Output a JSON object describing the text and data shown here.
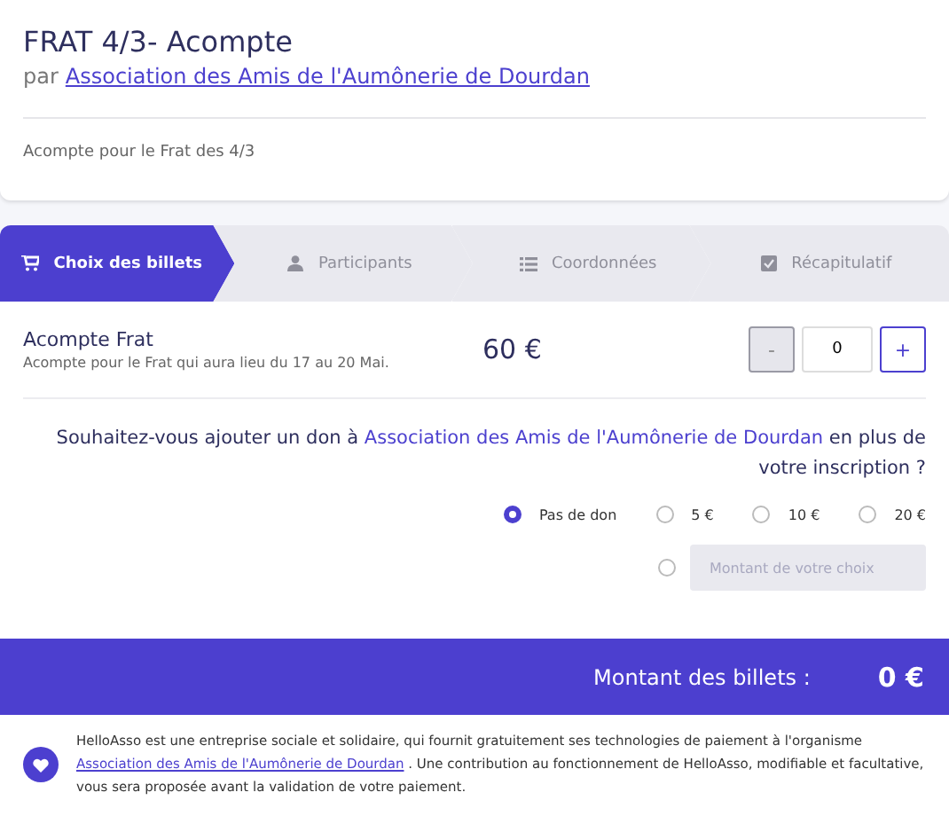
{
  "header": {
    "title": "FRAT 4/3- Acompte",
    "by": "par",
    "organizer": "Association des Amis de l'Aumônerie de Dourdan",
    "description": "Acompte pour le Frat des 4/3"
  },
  "steps": [
    {
      "label": "Choix des billets",
      "kind": "cart",
      "selected": true
    },
    {
      "label": "Participants",
      "kind": "user",
      "selected": false
    },
    {
      "label": "Coordonnées",
      "kind": "list",
      "selected": false
    },
    {
      "label": "Récapitulatif",
      "kind": "check",
      "selected": false
    }
  ],
  "ticket": {
    "name": "Acompte Frat",
    "description": "Acompte pour le Frat qui aura lieu du 17 au 20 Mai.",
    "price": "60 €",
    "minus": "-",
    "quantity": "0",
    "plus": "+",
    "minus_disabled": true
  },
  "donation": {
    "question_before": "Souhaitez-vous ajouter un don à",
    "question_org": "Association des Amis de l'Aumônerie de Dourdan",
    "question_after": "en plus de votre inscription ?",
    "options": [
      {
        "label": "Pas de don",
        "selected": true
      },
      {
        "label": "5 €",
        "selected": false
      },
      {
        "label": "10 €",
        "selected": false
      },
      {
        "label": "20 €",
        "selected": false
      }
    ],
    "custom": {
      "selected": false,
      "placeholder": "Montant de votre choix"
    }
  },
  "total": {
    "label": "Montant des billets :",
    "amount": "0 €"
  },
  "footer": {
    "before": "HelloAsso est une entreprise sociale et solidaire, qui fournit gratuitement ses technologies de paiement à l'organisme",
    "link": "Association des Amis de l'Aumônerie de Dourdan",
    "after": ". Une contribution au fonctionnement de HelloAsso, modifiable et facultative, vous sera proposée avant la validation de votre paiement."
  }
}
